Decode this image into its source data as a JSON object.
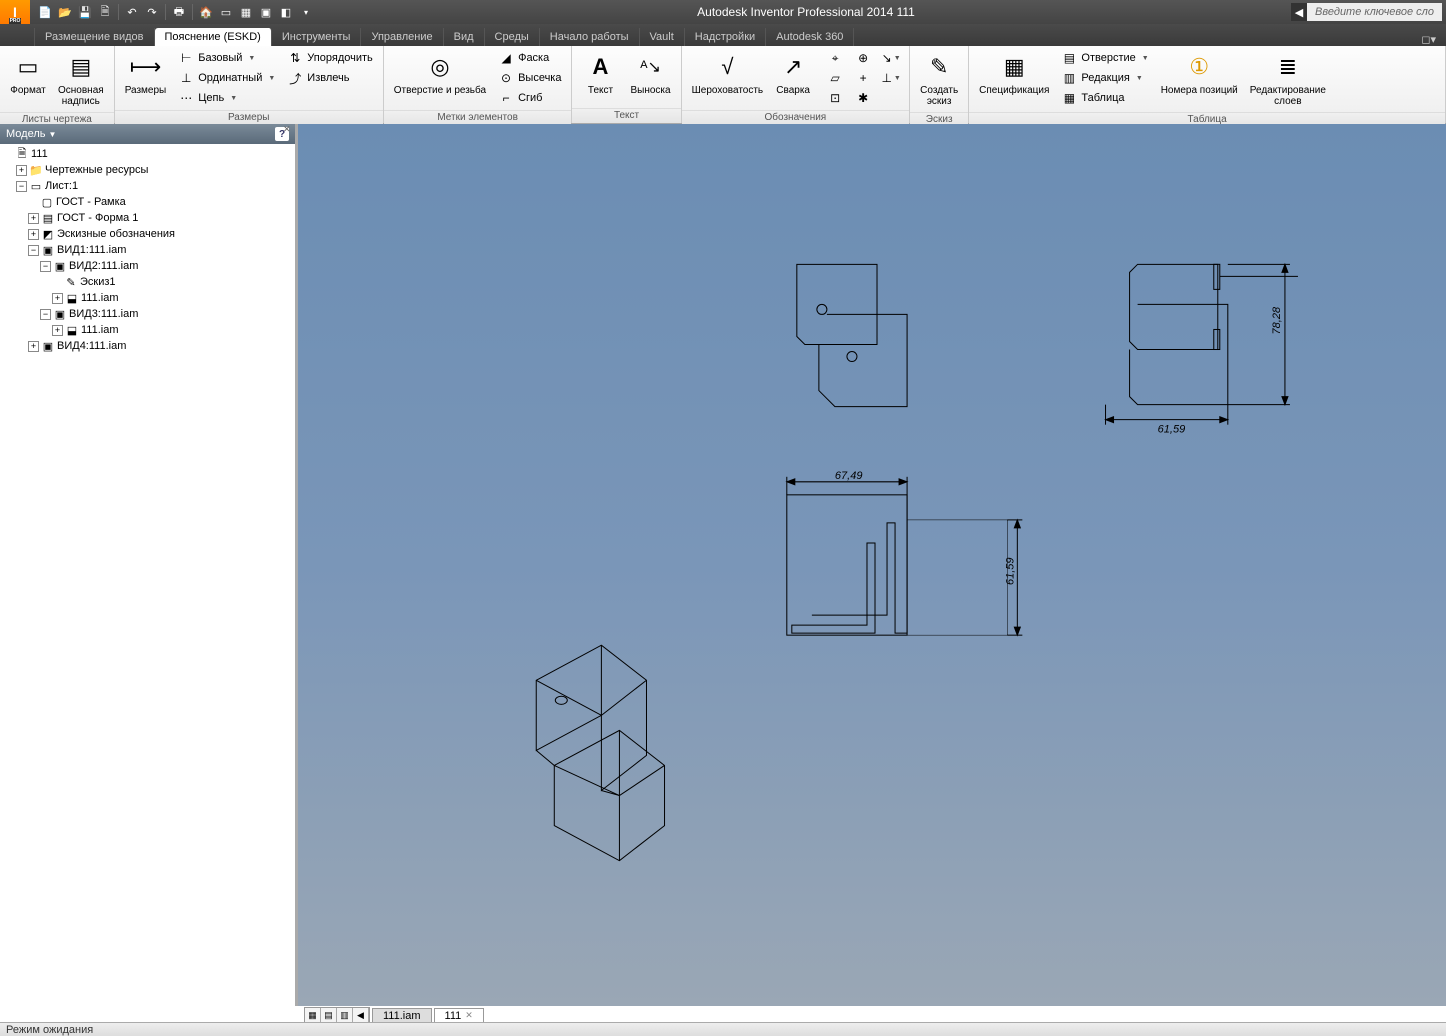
{
  "title": "Autodesk Inventor Professional 2014   111",
  "search_placeholder": "Введите ключевое сло",
  "tabs": {
    "placement": "Размещение видов",
    "annotation": "Пояснение (ESKD)",
    "tools": "Инструменты",
    "manage": "Управление",
    "view": "Вид",
    "env": "Среды",
    "getting_started": "Начало работы",
    "vault": "Vault",
    "addins": "Надстройки",
    "a360": "Autodesk 360"
  },
  "ribbon": {
    "sheet_views": {
      "label": "Листы чертежа",
      "format": "Формат",
      "main_caption": "Основная\nнадпись"
    },
    "dimensions": {
      "label": "Размеры",
      "dimension": "Размеры",
      "baseline": "Базовый",
      "ordinate": "Ординатный",
      "chain": "Цепь",
      "arrange": "Упорядочить",
      "retrieve": "Извлечь"
    },
    "feature_notes": {
      "label": "Метки элементов",
      "hole_thread": "Отверстие и резьба",
      "chamfer": "Фаска",
      "punch": "Высечка",
      "bend": "Сгиб"
    },
    "text": {
      "label": "Текст",
      "text": "Текст",
      "leader": "Выноска"
    },
    "symbols": {
      "label": "Обозначения",
      "surface": "Шероховатость",
      "welding": "Сварка"
    },
    "sketch": {
      "label": "Эскиз",
      "create": "Создать\nэскиз"
    },
    "table": {
      "label": "Таблица",
      "parts_list": "Спецификация",
      "hole": "Отверстие",
      "revision": "Редакция",
      "general": "Таблица",
      "balloon": "Номера позиций",
      "edit_layers": "Редактирование\nслоев"
    }
  },
  "panel": {
    "title": "Модель"
  },
  "tree": {
    "root": "111",
    "drawing_res": "Чертежные ресурсы",
    "sheet": "Лист:1",
    "gost_frame": "ГОСТ - Рамка",
    "gost_form": "ГОСТ - Форма 1",
    "sketch_symbols": "Эскизные обозначения",
    "view1": "ВИД1:111.iam",
    "view2": "ВИД2:111.iam",
    "sketch1": "Эскиз1",
    "iam": "111.iam",
    "view3": "ВИД3:111.iam",
    "iam2": "111.iam",
    "view4": "ВИД4:111.iam"
  },
  "dims": {
    "d1": "61,59",
    "d2": "78,28",
    "d3": "67,49",
    "d4": "61,59"
  },
  "doc_tabs": {
    "t1": "111.iam",
    "t2": "111"
  },
  "status": "Режим ожидания"
}
